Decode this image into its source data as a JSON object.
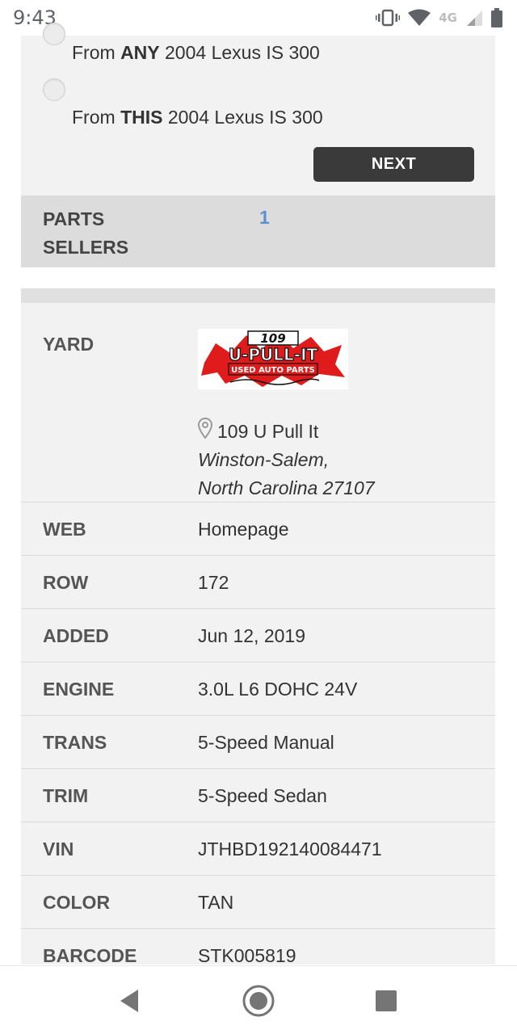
{
  "status_bar": {
    "time": "9:43",
    "network": "4G",
    "icons": [
      "vibrate-icon",
      "wifi-icon",
      "signal-icon",
      "battery-icon"
    ]
  },
  "options": {
    "any": {
      "prefix": "From ",
      "bold": "ANY",
      "suffix": " 2004 Lexus IS 300"
    },
    "this": {
      "prefix": "From ",
      "bold": "THIS",
      "suffix": " 2004 Lexus IS 300"
    },
    "next_label": "NEXT"
  },
  "parts_sellers": {
    "label": "PARTS SELLERS",
    "count": "1"
  },
  "yard": {
    "label": "YARD",
    "logo": {
      "number": "109",
      "name": "U-PULL-IT",
      "tagline": "USED AUTO PARTS"
    },
    "name": "109 U Pull It",
    "city": "Winston-Salem,",
    "state_zip": "North Carolina 27107"
  },
  "details": [
    {
      "label": "WEB",
      "value": "Homepage"
    },
    {
      "label": "ROW",
      "value": "172"
    },
    {
      "label": "ADDED",
      "value": "Jun 12, 2019"
    },
    {
      "label": "ENGINE",
      "value": "3.0L L6 DOHC 24V"
    },
    {
      "label": "TRANS",
      "value": "5-Speed Manual"
    },
    {
      "label": "TRIM",
      "value": "5-Speed Sedan"
    },
    {
      "label": "VIN",
      "value": "JTHBD192140084471"
    },
    {
      "label": "COLOR",
      "value": "TAN"
    },
    {
      "label": "BARCODE",
      "value": "STK005819"
    }
  ],
  "colors": {
    "button": "#3a3a3a",
    "link": "#5b8fd6",
    "logo_red": "#e01b1b"
  },
  "nav_bar": {
    "icons": [
      "back-icon",
      "home-icon",
      "recent-apps-icon"
    ]
  }
}
